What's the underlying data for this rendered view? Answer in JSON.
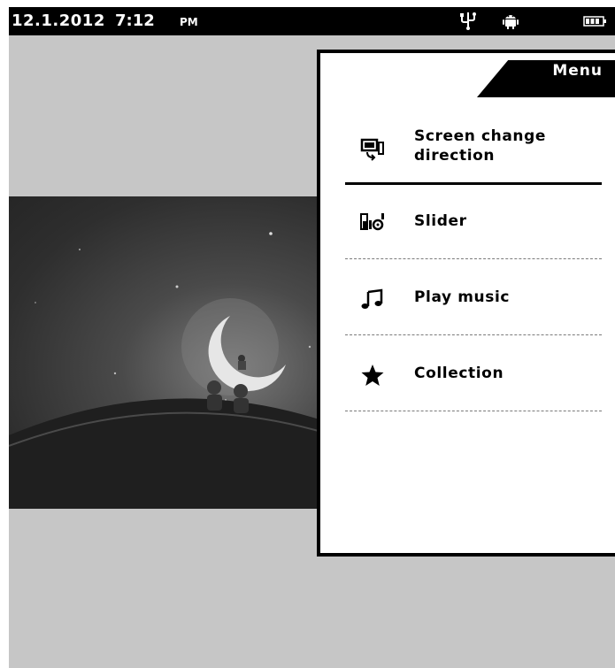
{
  "status_bar": {
    "date": "12.1.2012",
    "time": "7:12",
    "ampm": "PM",
    "icons": [
      "usb-icon",
      "android-icon",
      "battery-icon"
    ]
  },
  "menu": {
    "title": "Menu",
    "items": [
      {
        "label_line1": "Screen change",
        "label_line2": "direction",
        "icon": "screen-rotate-icon"
      },
      {
        "label": "Slider",
        "icon": "slideshow-icon"
      },
      {
        "label": "Play music",
        "icon": "music-note-icon"
      },
      {
        "label": "Collection",
        "icon": "star-icon"
      }
    ]
  },
  "colors": {
    "background": "#c6c6c6",
    "status_bar": "#000000",
    "panel": "#ffffff"
  }
}
